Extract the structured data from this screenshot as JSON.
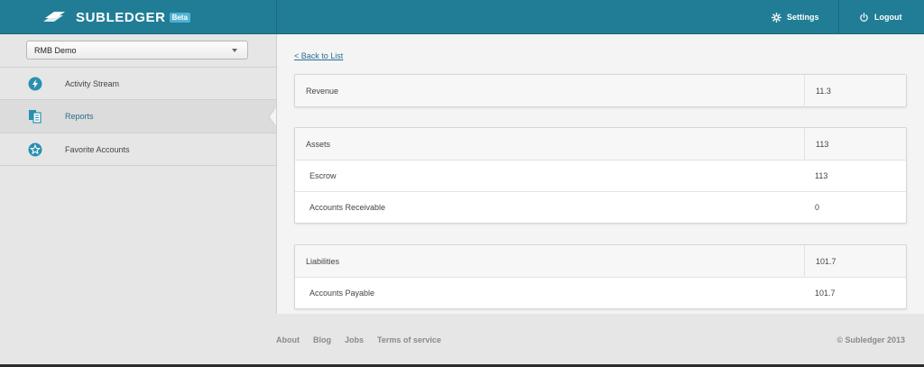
{
  "header": {
    "brand": "SUBLEDGER",
    "badge": "Beta",
    "settings_label": "Settings",
    "logout_label": "Logout"
  },
  "sidebar": {
    "account_select": "RMB Demo",
    "items": [
      {
        "label": "Activity Stream",
        "icon": "lightning-icon"
      },
      {
        "label": "Reports",
        "icon": "reports-icon"
      },
      {
        "label": "Favorite Accounts",
        "icon": "star-icon"
      }
    ]
  },
  "main": {
    "back_link": "< Back to List",
    "revenue": {
      "label": "Revenue",
      "value": "11.3"
    },
    "assets": {
      "label": "Assets",
      "value": "113",
      "children": [
        {
          "label": "Escrow",
          "value": "113"
        },
        {
          "label": "Accounts Receivable",
          "value": "0"
        }
      ]
    },
    "liabilities": {
      "label": "Liabilities",
      "value": "101.7",
      "children": [
        {
          "label": "Accounts Payable",
          "value": "101.7"
        }
      ]
    }
  },
  "footer": {
    "links": [
      "About",
      "Blog",
      "Jobs",
      "Terms of service"
    ],
    "copyright": "© Subledger 2013"
  },
  "colors": {
    "header": "#217d96",
    "link": "#2a6d9a",
    "icon": "#2a8fb0"
  }
}
